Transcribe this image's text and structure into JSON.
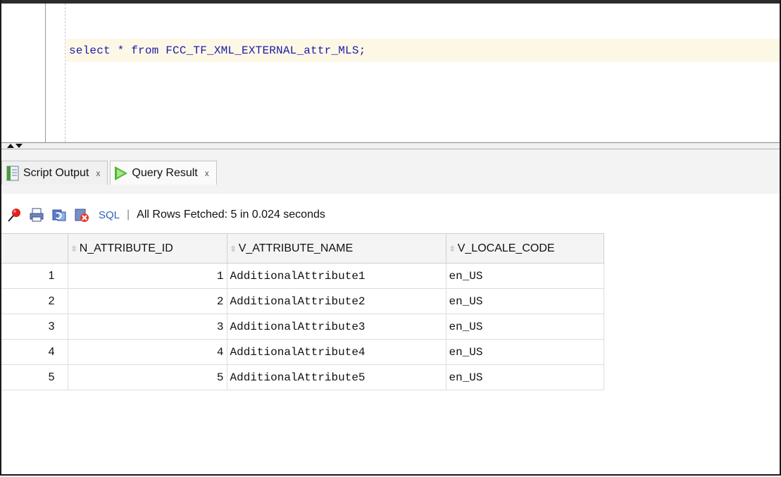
{
  "editor": {
    "sql_text": "select * from FCC_TF_XML_EXTERNAL_attr_MLS;"
  },
  "tabs": [
    {
      "label": "Script Output",
      "close": "x",
      "icon": "script-output-icon"
    },
    {
      "label": "Query Result",
      "close": "x",
      "icon": "run-play-icon"
    }
  ],
  "toolbar": {
    "icons": [
      "pin-icon",
      "print-icon",
      "refresh-icon",
      "clear-icon"
    ],
    "sql_label": "SQL",
    "separator": "|",
    "status": "All Rows Fetched: 5 in 0.024 seconds"
  },
  "grid": {
    "columns": [
      "N_ATTRIBUTE_ID",
      "V_ATTRIBUTE_NAME",
      "V_LOCALE_CODE"
    ],
    "rows": [
      {
        "num": "1",
        "id": "1",
        "name": "AdditionalAttribute1",
        "locale": "en_US"
      },
      {
        "num": "2",
        "id": "2",
        "name": "AdditionalAttribute2",
        "locale": "en_US"
      },
      {
        "num": "3",
        "id": "3",
        "name": "AdditionalAttribute3",
        "locale": "en_US"
      },
      {
        "num": "4",
        "id": "4",
        "name": "AdditionalAttribute4",
        "locale": "en_US"
      },
      {
        "num": "5",
        "id": "5",
        "name": "AdditionalAttribute5",
        "locale": "en_US"
      }
    ]
  },
  "colors": {
    "sql_text": "#1b1ba8",
    "current_line": "#fdf8e6",
    "play_green": "#4fb832",
    "sql_link": "#2b63b5"
  }
}
